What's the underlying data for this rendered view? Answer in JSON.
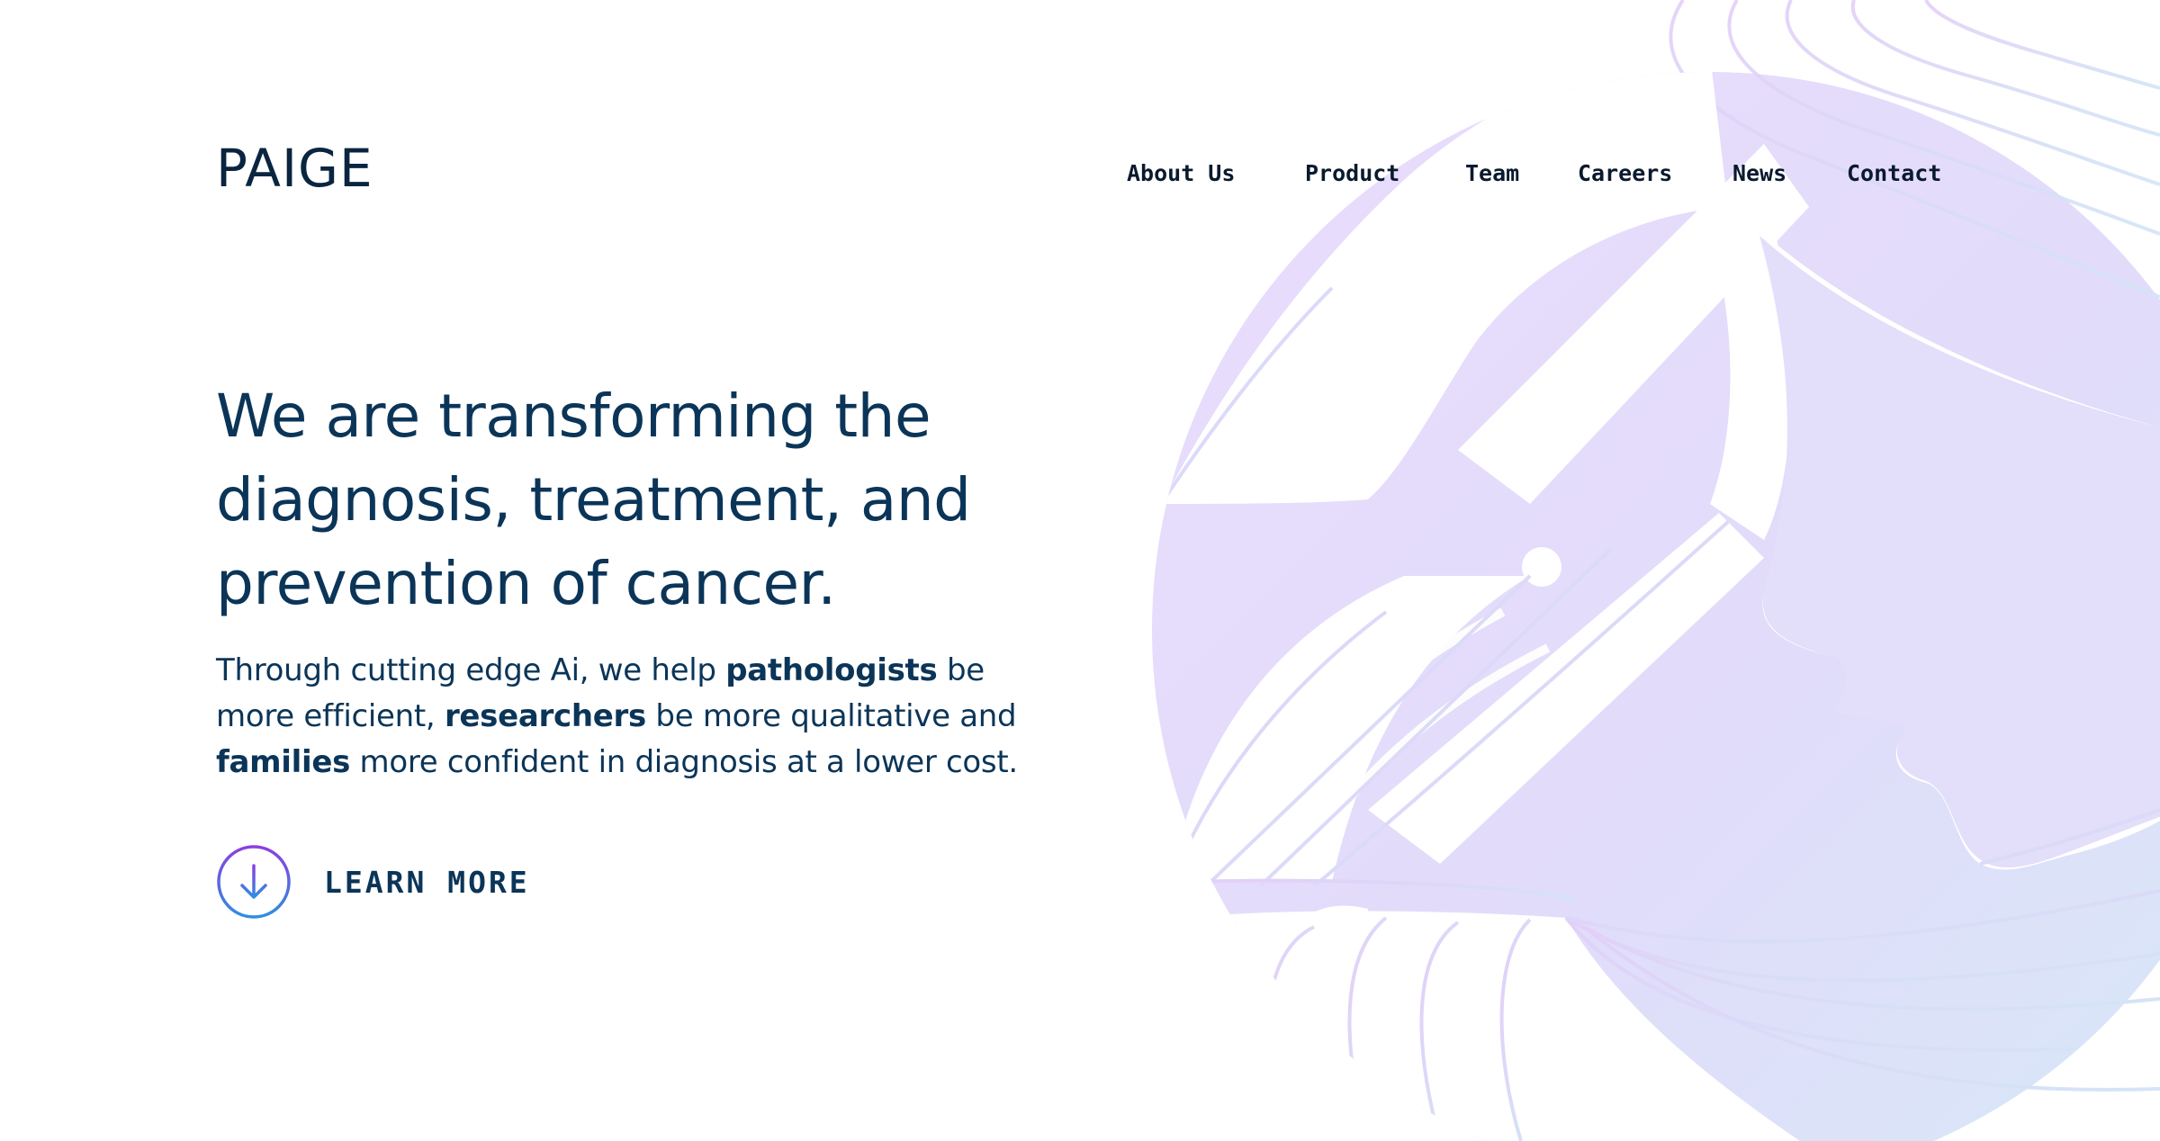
{
  "brand": {
    "logo_text": "PAIGE"
  },
  "nav": {
    "items": [
      {
        "label": "About Us"
      },
      {
        "label": "Product"
      },
      {
        "label": "Team"
      },
      {
        "label": "Careers"
      },
      {
        "label": "News"
      },
      {
        "label": "Contact"
      }
    ]
  },
  "hero": {
    "headline_lines": [
      "We are transforming the",
      "diagnosis, treatment, and",
      "prevention of cancer."
    ],
    "subtext": {
      "p1": "Through cutting edge Ai, we help ",
      "b1": "pathologists",
      "p2": " be more efficient, ",
      "b2": "researchers",
      "p3": " be more qualitative and ",
      "b3": "families",
      "p4": " more confident in diagnosis at a lower cost."
    },
    "cta_label": "LEARN MORE"
  },
  "icons": {
    "cta": "arrow-down-circle-icon",
    "illustration": "abstract-face-profile-illustration"
  },
  "colors": {
    "text": "#0b3558",
    "logo": "#0a2540",
    "nav": "#0a1a2e",
    "gradient_purple": "#8b3fe0",
    "gradient_blue": "#2f8ee0",
    "art_purple": "#e6d9fb",
    "art_blue": "#dbe8f8"
  }
}
